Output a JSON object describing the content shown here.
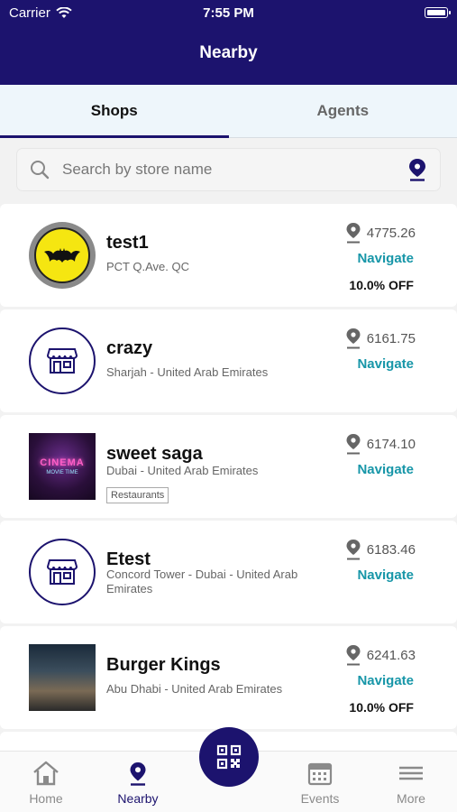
{
  "status_bar": {
    "carrier": "Carrier",
    "time": "7:55 PM"
  },
  "header": {
    "title": "Nearby"
  },
  "tabs": [
    {
      "label": "Shops",
      "active": true
    },
    {
      "label": "Agents",
      "active": false
    }
  ],
  "search": {
    "placeholder": "Search by store name"
  },
  "shops": [
    {
      "name": "test1",
      "address": "PCT Q.Ave. QC",
      "distance": "4775.26",
      "navigate": "Navigate",
      "offer": "10.0% OFF",
      "image": "batman-logo"
    },
    {
      "name": "crazy",
      "address": "Sharjah - United Arab Emirates",
      "distance": "6161.75",
      "navigate": "Navigate",
      "image": "store-icon"
    },
    {
      "name": "sweet saga",
      "address": "Dubai - United Arab Emirates",
      "tag": "Restaurants",
      "distance": "6174.10",
      "navigate": "Navigate",
      "image": "neon-cinema",
      "image_text": "CINEMA",
      "image_subtext": "MOVIE TIME"
    },
    {
      "name": "Etest",
      "address": "Concord Tower - Dubai - United Arab Emirates",
      "distance": "6183.46",
      "navigate": "Navigate",
      "image": "store-icon"
    },
    {
      "name": "Burger Kings",
      "address": "Abu Dhabi - United Arab Emirates",
      "distance": "6241.63",
      "navigate": "Navigate",
      "offer": "10.0% OFF",
      "image": "crowd-photo"
    }
  ],
  "bottom_nav": [
    {
      "label": "Home",
      "icon": "home-icon",
      "active": false
    },
    {
      "label": "Nearby",
      "icon": "location-pin-icon",
      "active": true
    },
    {
      "label": "Events",
      "icon": "calendar-icon",
      "active": false
    },
    {
      "label": "More",
      "icon": "menu-icon",
      "active": false
    }
  ],
  "colors": {
    "primary": "#1c136e",
    "link": "#1796a8",
    "tab_bg": "#eef6fb"
  }
}
